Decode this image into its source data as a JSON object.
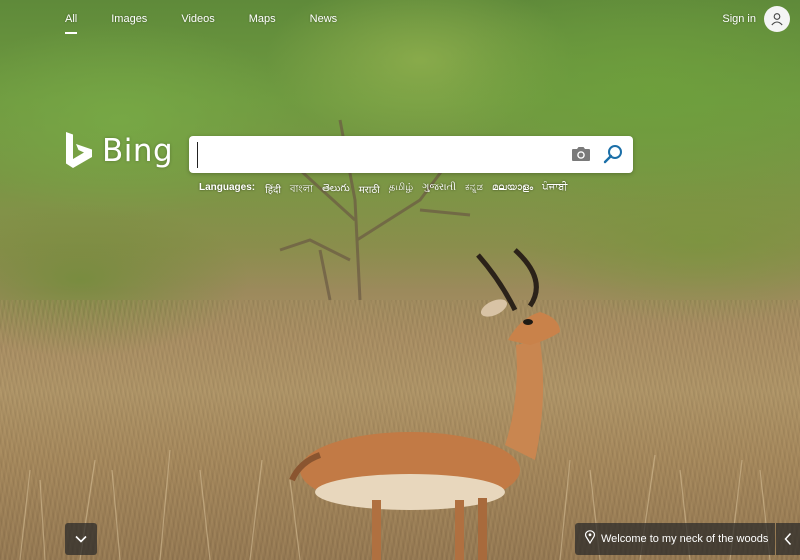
{
  "nav": {
    "tabs": [
      {
        "label": "All",
        "active": true
      },
      {
        "label": "Images"
      },
      {
        "label": "Videos"
      },
      {
        "label": "Maps"
      },
      {
        "label": "News"
      }
    ],
    "signin_label": "Sign in"
  },
  "logo": {
    "text": "Bing"
  },
  "search": {
    "value": "",
    "placeholder": ""
  },
  "languages": {
    "label": "Languages:",
    "items": [
      "हिंदी",
      "বাংলা",
      "తెలుగు",
      "मराठी",
      "தமிழ்",
      "ગુજરાતી",
      "ಕನ್ನಡ",
      "മലയാളം",
      "ਪੰਜਾਬੀ"
    ]
  },
  "caption": {
    "text": "Welcome to my neck of the woods"
  },
  "icons": {
    "logo": "bing-logo-icon",
    "avatar": "user-icon",
    "camera": "camera-icon",
    "search": "search-icon",
    "scroll": "chevron-down-icon",
    "pin": "location-pin-icon",
    "prev": "chevron-left-icon"
  },
  "colors": {
    "search_icon": "#1b6fa8",
    "overlay": "#282828"
  }
}
